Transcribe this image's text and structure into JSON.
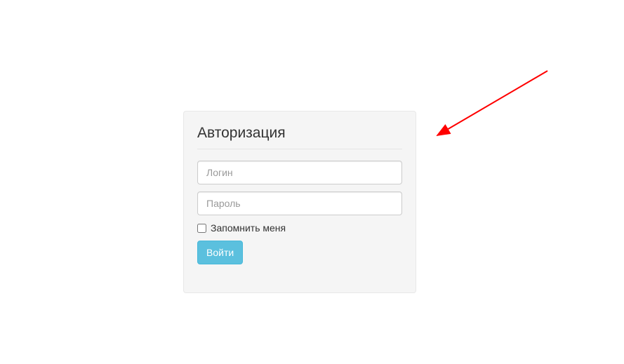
{
  "login": {
    "title": "Авторизация",
    "username_placeholder": "Логин",
    "password_placeholder": "Пароль",
    "remember_label": "Запомнить меня",
    "submit_label": "Войти"
  }
}
